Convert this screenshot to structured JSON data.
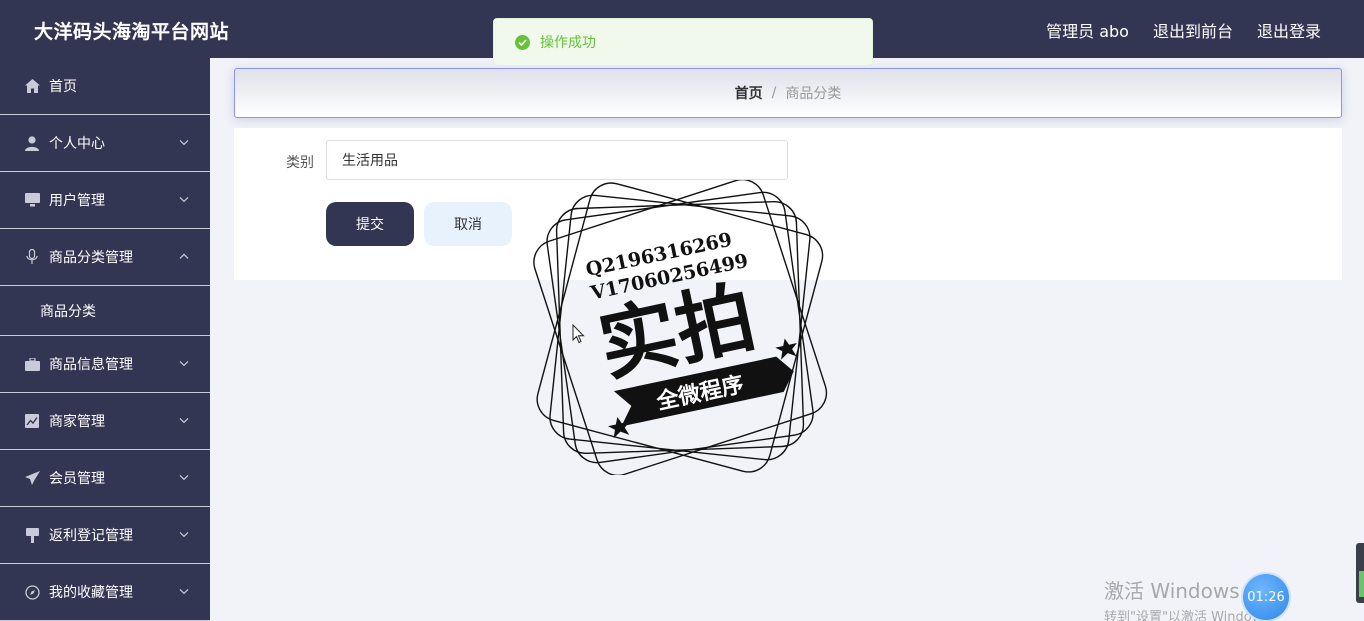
{
  "header": {
    "site_title": "大洋码头海淘平台网站",
    "admin_label": "管理员 abo",
    "to_frontend": "退出到前台",
    "logout": "退出登录"
  },
  "sidebar": {
    "items": [
      {
        "label": "首页",
        "icon": "home-icon",
        "chevron": "none"
      },
      {
        "label": "个人中心",
        "icon": "user-icon",
        "chevron": "down"
      },
      {
        "label": "用户管理",
        "icon": "monitor-icon",
        "chevron": "down"
      },
      {
        "label": "商品分类管理",
        "icon": "microphone-icon",
        "chevron": "up"
      },
      {
        "label": "商品分类",
        "icon": "",
        "chevron": "none"
      },
      {
        "label": "商品信息管理",
        "icon": "briefcase-icon",
        "chevron": "down"
      },
      {
        "label": "商家管理",
        "icon": "chart-icon",
        "chevron": "down"
      },
      {
        "label": "会员管理",
        "icon": "send-icon",
        "chevron": "down"
      },
      {
        "label": "返利登记管理",
        "icon": "stamp-icon",
        "chevron": "down"
      },
      {
        "label": "我的收藏管理",
        "icon": "compass-icon",
        "chevron": "down"
      }
    ]
  },
  "breadcrumb": {
    "home": "首页",
    "separator": "/",
    "current": "商品分类"
  },
  "form": {
    "category_label": "类别",
    "category_value": "生活用品",
    "submit": "提交",
    "cancel": "取消"
  },
  "toast": {
    "message": "操作成功"
  },
  "watermark": {
    "line1": "Q2196316269",
    "line2": "V17060256499",
    "main": "实拍",
    "banner": "全微程序"
  },
  "system": {
    "activate_title": "激活 Windows",
    "activate_sub": "转到\"设置\"以激活 Windows。",
    "timer": "01:26"
  },
  "colors": {
    "sidebar_bg": "#333652",
    "header_bg": "#333652",
    "success": "#67c23a",
    "primary_button": "#333652",
    "cancel_button": "#e8f2fd"
  }
}
